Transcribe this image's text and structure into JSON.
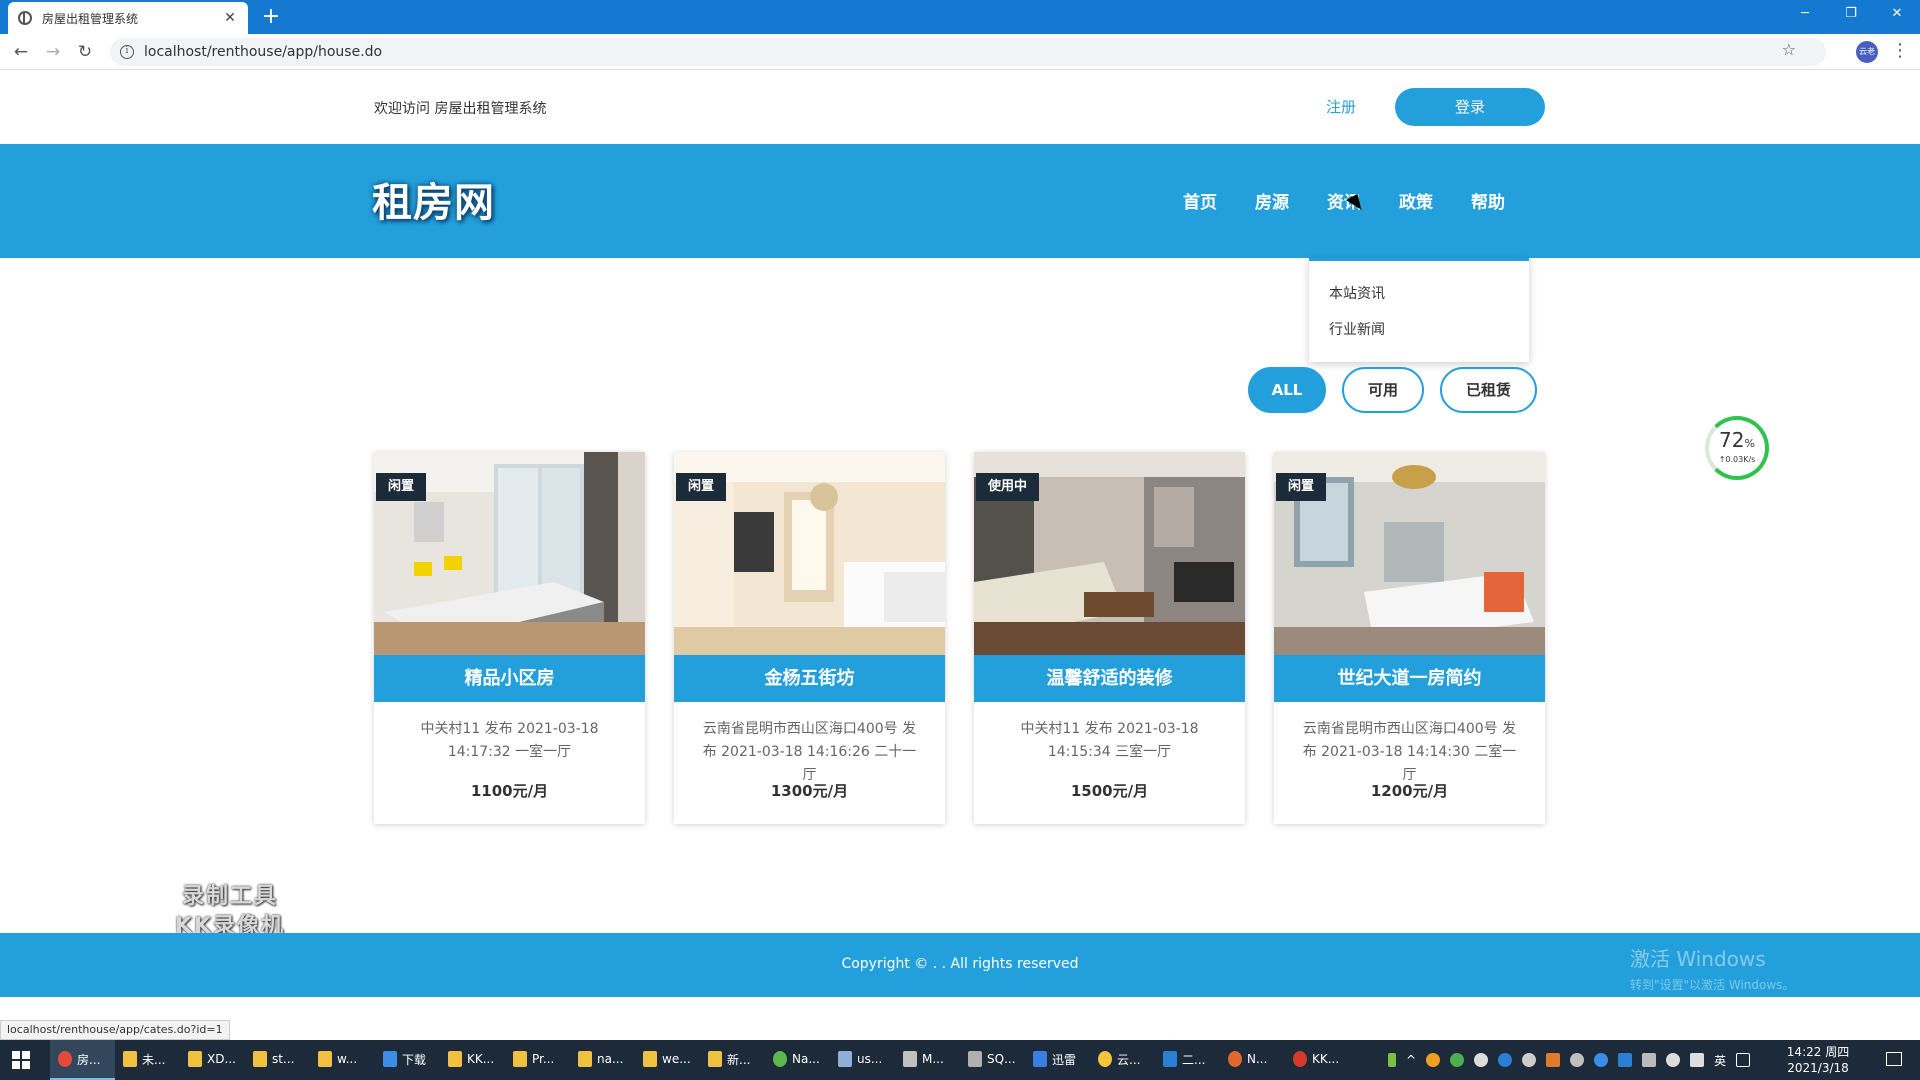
{
  "browser": {
    "tab_title": "房屋出租管理系统",
    "url": "localhost/renthouse/app/house.do",
    "profile_label": "云老",
    "status_url": "localhost/renthouse/app/cates.do?id=1"
  },
  "topbar": {
    "welcome": "欢迎访问 房屋出租管理系统",
    "register": "注册",
    "login": "登录"
  },
  "header": {
    "logo": "租房网",
    "nav": [
      "首页",
      "房源",
      "资讯",
      "政策",
      "帮助"
    ]
  },
  "dropdown": {
    "items": [
      "本站资讯",
      "行业新闻"
    ]
  },
  "filters": [
    "ALL",
    "可用",
    "已租赁"
  ],
  "speed_widget": {
    "percent": "72",
    "unit": "%",
    "rate": "↑0.03K/s"
  },
  "houses": [
    {
      "badge": "闲置",
      "title": "精品小区房",
      "desc": "中关村11 发布 2021-03-18 14:17:32 一室一厅",
      "price": "1100元/月"
    },
    {
      "badge": "闲置",
      "title": "金杨五街坊",
      "desc": "云南省昆明市西山区海口400号 发布 2021-03-18 14:16:26 二十一厅",
      "price": "1300元/月"
    },
    {
      "badge": "使用中",
      "title": "温馨舒适的装修",
      "desc": "中关村11 发布 2021-03-18 14:15:34 三室一厅",
      "price": "1500元/月"
    },
    {
      "badge": "闲置",
      "title": "世纪大道一房简约",
      "desc": "云南省昆明市西山区海口400号 发布 2021-03-18 14:14:30 二室一厅",
      "price": "1200元/月"
    }
  ],
  "watermark": {
    "line1": "录制工具",
    "line2": "KK录像机"
  },
  "footer": {
    "copyright": "Copyright © . . All rights reserved",
    "activate_title": "激活 Windows",
    "activate_sub": "转到\"设置\"以激活 Windows。"
  },
  "taskbar": {
    "tasks": [
      "房...",
      "未...",
      "XD...",
      "st...",
      "w...",
      "下载",
      "KK...",
      "Pr...",
      "na...",
      "we...",
      "新...",
      "Na...",
      "us...",
      "M...",
      "SQ...",
      "迅雷",
      "云...",
      "二...",
      "N...",
      "KK..."
    ],
    "ime": "英",
    "time": "14:22 周四",
    "date": "2021/3/18"
  }
}
